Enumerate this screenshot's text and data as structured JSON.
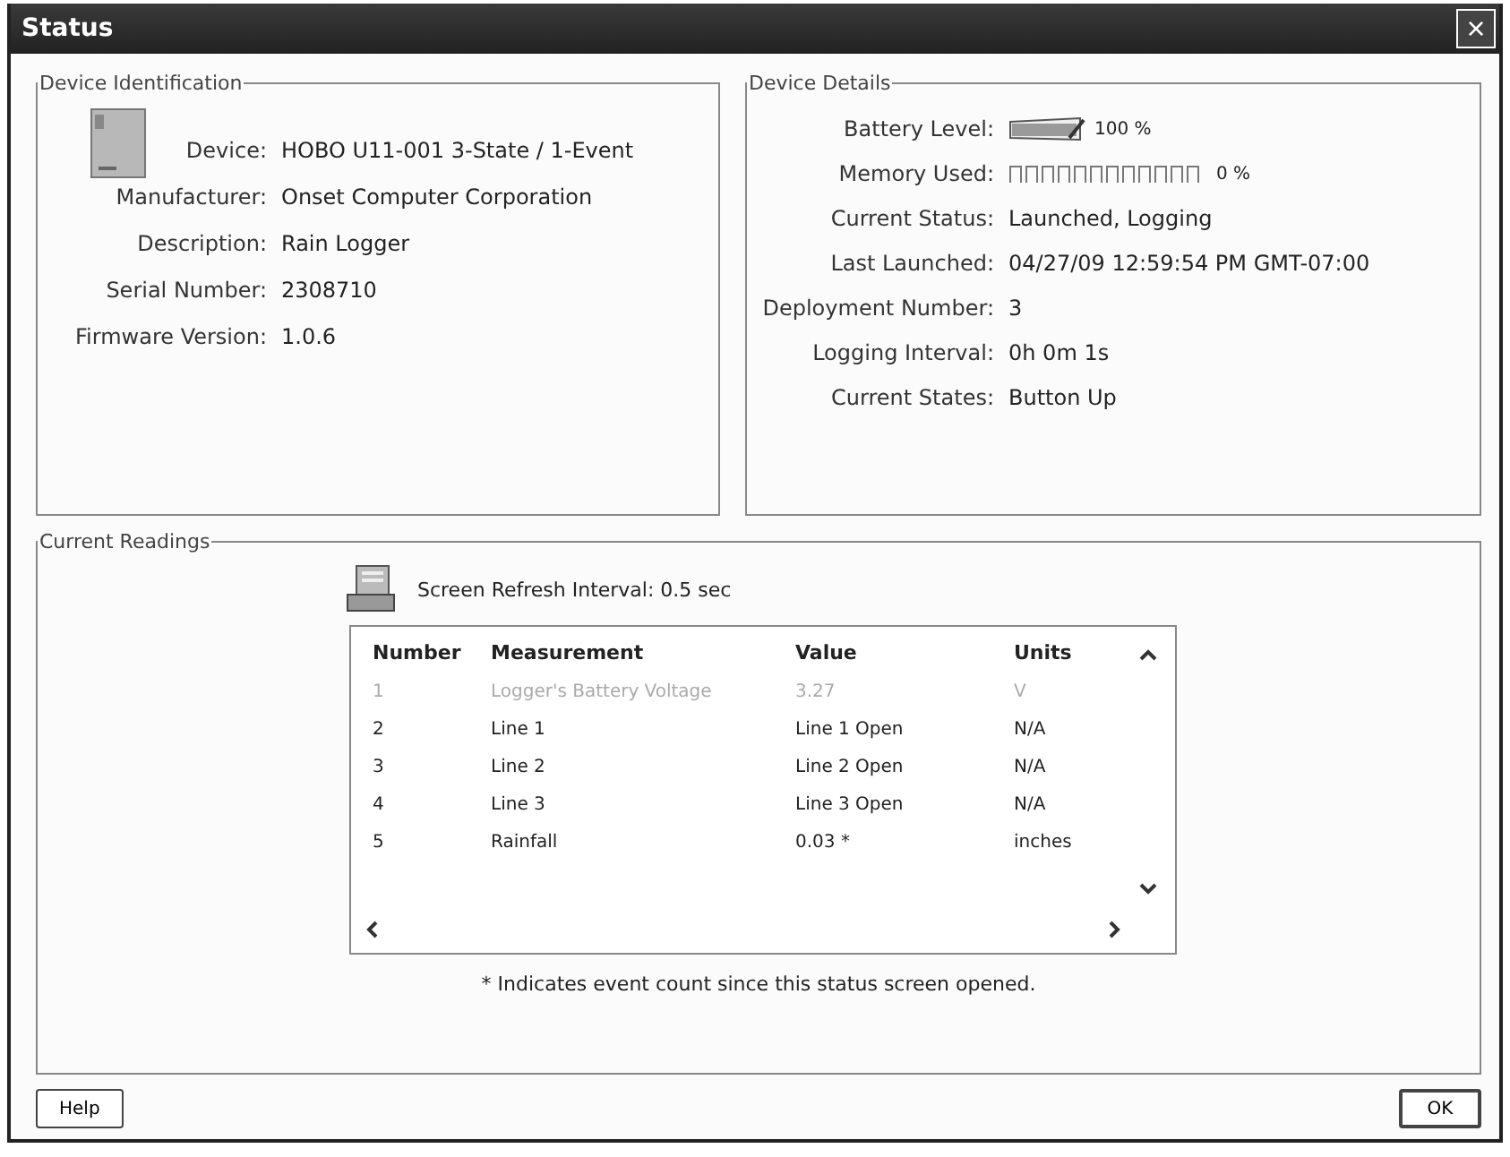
{
  "window": {
    "title": "Status",
    "close": "×"
  },
  "device_identification": {
    "title": "Device Identification",
    "fields": [
      {
        "label": "Device:",
        "value": "HOBO U11-001 3-State / 1-Event"
      },
      {
        "label": "Manufacturer:",
        "value": "Onset Computer Corporation"
      },
      {
        "label": "Description:",
        "value": "Rain Logger"
      },
      {
        "label": "Serial Number:",
        "value": "2308710"
      },
      {
        "label": "Firmware Version:",
        "value": "1.0.6"
      }
    ]
  },
  "device_details": {
    "title": "Device Details",
    "fields": [
      {
        "kind": "battery",
        "label": "Battery Level:",
        "level": 1.0,
        "value": "100 %"
      },
      {
        "kind": "memory",
        "label": "Memory Used:",
        "level": 0.0,
        "value": "0 %"
      },
      {
        "kind": "text",
        "label": "Current Status:",
        "value": "Launched, Logging"
      },
      {
        "kind": "text",
        "label": "Last Launched:",
        "value": "04/27/09 12:59:54 PM GMT-07:00"
      },
      {
        "kind": "text",
        "label": "Deployment Number:",
        "value": "3"
      },
      {
        "kind": "text",
        "label": "Logging Interval:",
        "value": "0h 0m 1s"
      },
      {
        "kind": "text",
        "label": "Current States:",
        "value": "Button Up"
      }
    ]
  },
  "current_readings": {
    "title": "Current Readings",
    "refresh": "Screen Refresh Interval:  0.5 sec",
    "table": {
      "columns": [
        "Number",
        "Measurement",
        "Value",
        "Units"
      ],
      "rows": [
        {
          "disabled": true,
          "cells": [
            "1",
            "Logger's Battery Voltage",
            "3.27",
            "V"
          ]
        },
        {
          "disabled": false,
          "cells": [
            "2",
            "Line 1",
            "Line 1 Open",
            "N/A"
          ]
        },
        {
          "disabled": false,
          "cells": [
            "3",
            "Line 2",
            "Line 2 Open",
            "N/A"
          ]
        },
        {
          "disabled": false,
          "cells": [
            "4",
            "Line 3",
            "Line 3 Open",
            "N/A"
          ]
        },
        {
          "disabled": false,
          "cells": [
            "5",
            "Rainfall",
            "0.03 *",
            "inches"
          ]
        }
      ]
    },
    "footnote": "* Indicates event count since this status screen opened."
  },
  "buttons": [
    {
      "kind": "help",
      "label": "Help"
    },
    {
      "kind": "ok",
      "label": "OK"
    }
  ]
}
